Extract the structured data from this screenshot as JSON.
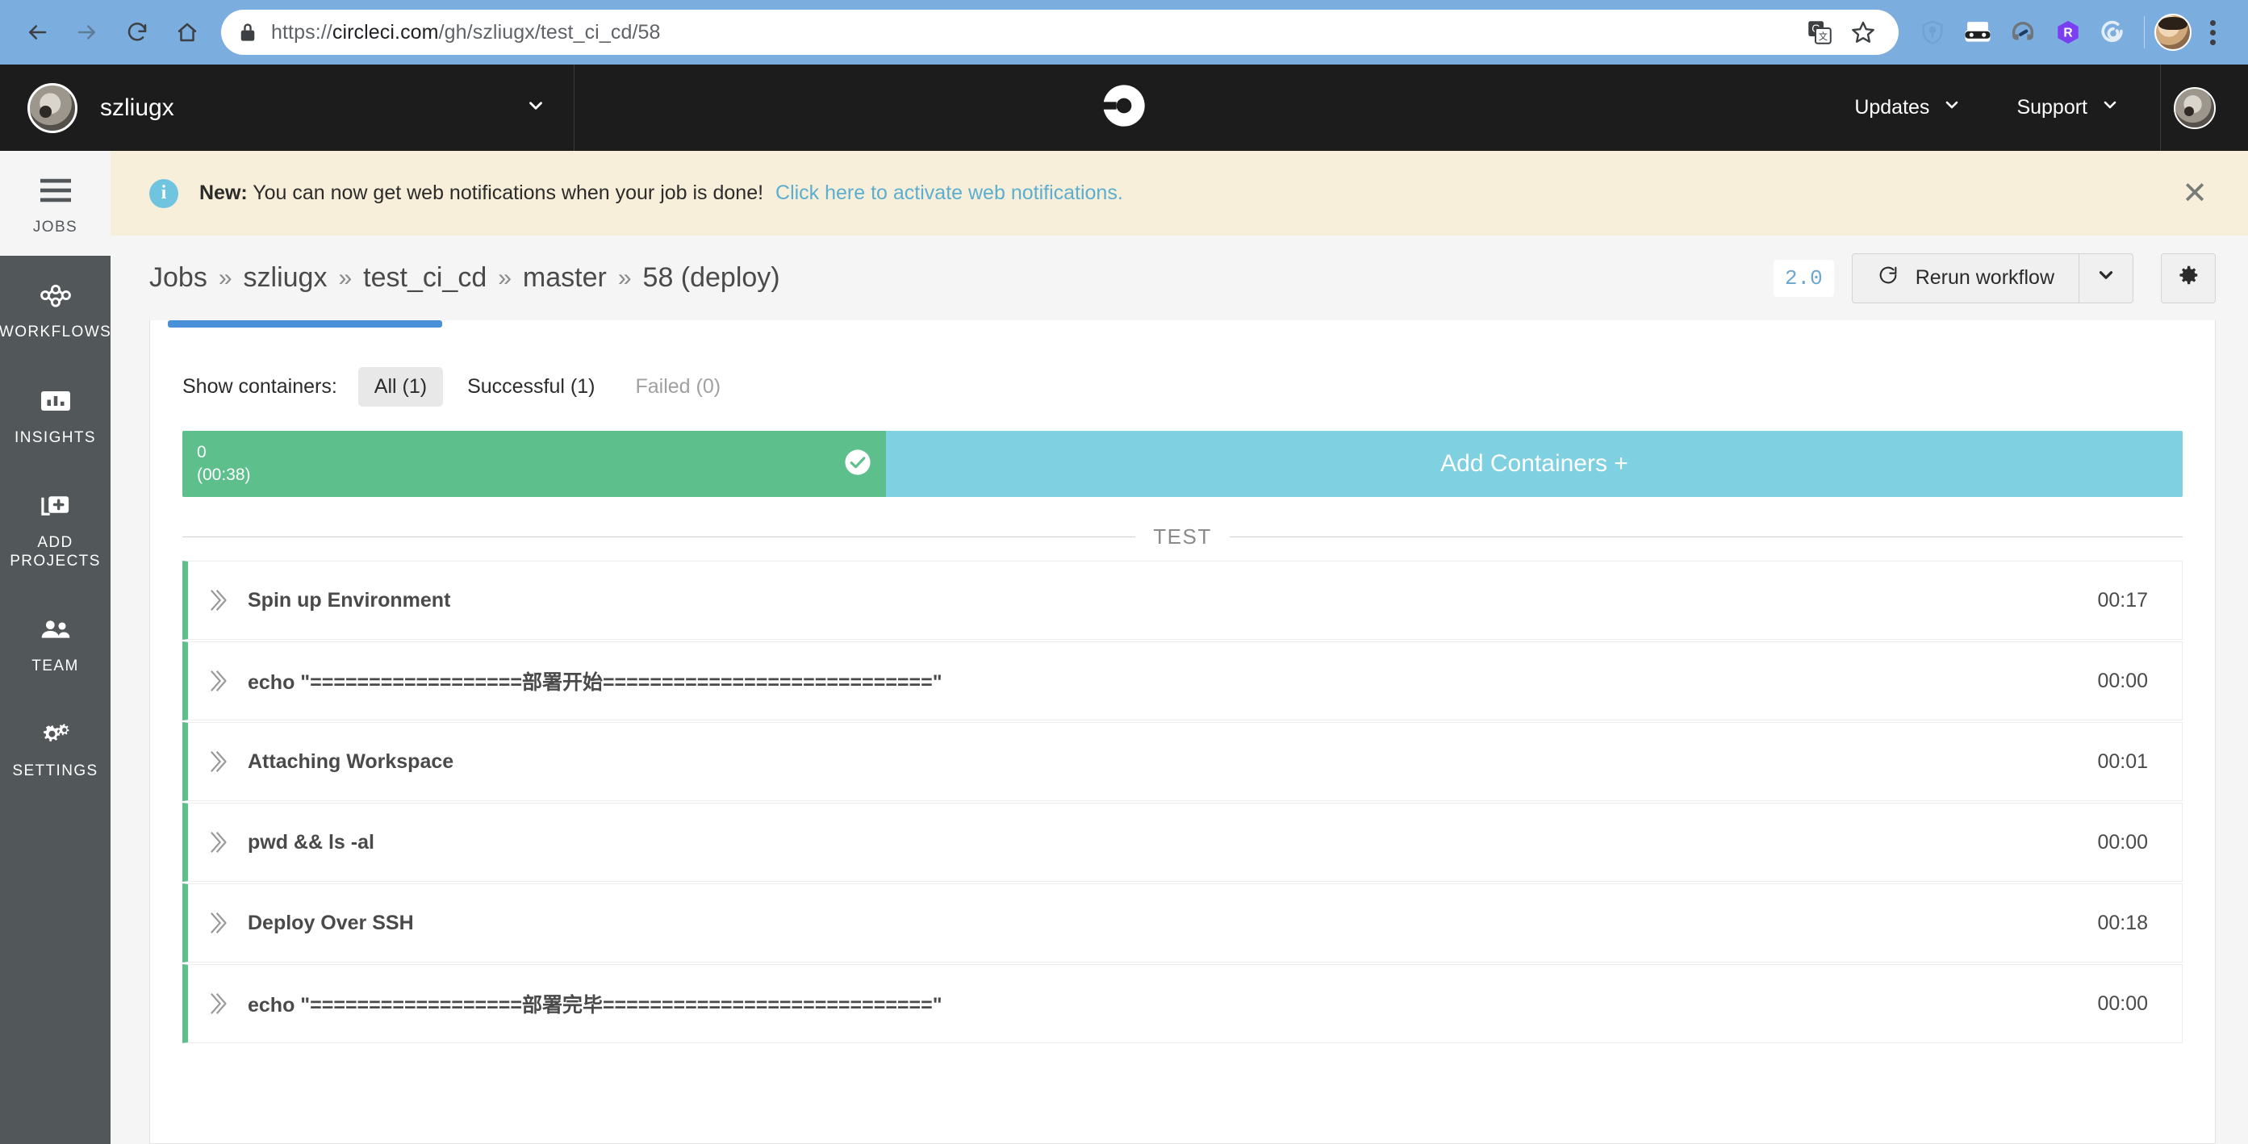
{
  "browser": {
    "url_scheme": "https://",
    "url_domain": "circleci.com",
    "url_path": "/gh/szliugx/test_ci_cd/58",
    "back_icon": "back-arrow-icon",
    "forward_icon": "forward-arrow-icon",
    "reload_icon": "reload-icon",
    "home_icon": "home-icon",
    "lock_icon": "lock-icon",
    "translate_icon": "translate-icon",
    "bookmark_icon": "star-icon",
    "extensions": [
      "shield-icon",
      "mask-icon",
      "headphones-icon",
      "r-hexagon-icon",
      "spiral-icon"
    ],
    "menu_icon": "kebab-menu-icon"
  },
  "topnav": {
    "org_name": "szliugx",
    "org_caret_icon": "chevron-down-icon",
    "logo_icon": "circleci-logo-icon",
    "links": [
      {
        "label": "Updates",
        "icon": "chevron-down-icon"
      },
      {
        "label": "Support",
        "icon": "chevron-down-icon"
      }
    ],
    "avatar": "user-avatar"
  },
  "sidebar": {
    "items": [
      {
        "label": "JOBS",
        "icon": "list-icon",
        "active": true
      },
      {
        "label": "WORKFLOWS",
        "icon": "workflow-icon",
        "active": false
      },
      {
        "label": "INSIGHTS",
        "icon": "bar-chart-icon",
        "active": false
      },
      {
        "label": "ADD PROJECTS",
        "icon": "add-project-icon",
        "active": false
      },
      {
        "label": "TEAM",
        "icon": "people-icon",
        "active": false
      },
      {
        "label": "SETTINGS",
        "icon": "gears-icon",
        "active": false
      }
    ]
  },
  "banner": {
    "icon": "info-icon",
    "bold_prefix": "New:",
    "message": "You can now get web notifications when your job is done!",
    "link": "Click here to activate web notifications.",
    "close_icon": "close-icon"
  },
  "breadcrumb": {
    "items": [
      "Jobs",
      "szliugx",
      "test_ci_cd",
      "master",
      "58 (deploy)"
    ],
    "separator": "»"
  },
  "actions": {
    "version_badge": "2.0",
    "rerun_label": "Rerun workflow",
    "rerun_icon": "refresh-icon",
    "caret_icon": "chevron-down-icon",
    "gear_icon": "gear-icon"
  },
  "filters": {
    "label": "Show containers:",
    "options": [
      {
        "label": "All (1)",
        "state": "active"
      },
      {
        "label": "Successful (1)",
        "state": "normal"
      },
      {
        "label": "Failed (0)",
        "state": "muted"
      }
    ]
  },
  "containers": {
    "index": "0",
    "duration": "(00:38)",
    "status_icon": "check-circle-icon",
    "add_label": "Add Containers +",
    "green": "#5dc08c",
    "blue": "#7fd0e0"
  },
  "section": {
    "divider_label": "TEST"
  },
  "steps": [
    {
      "name": "Spin up Environment",
      "time": "00:17",
      "icon": "double-chevron-icon"
    },
    {
      "name": "echo \"==================部署开始============================\"",
      "time": "00:00",
      "icon": "double-chevron-icon"
    },
    {
      "name": "Attaching Workspace",
      "time": "00:01",
      "icon": "double-chevron-icon"
    },
    {
      "name": "pwd && ls -al",
      "time": "00:00",
      "icon": "double-chevron-icon"
    },
    {
      "name": "Deploy Over SSH",
      "time": "00:18",
      "icon": "double-chevron-icon"
    },
    {
      "name": "echo \"==================部署完毕============================\"",
      "time": "00:00",
      "icon": "double-chevron-icon"
    }
  ]
}
